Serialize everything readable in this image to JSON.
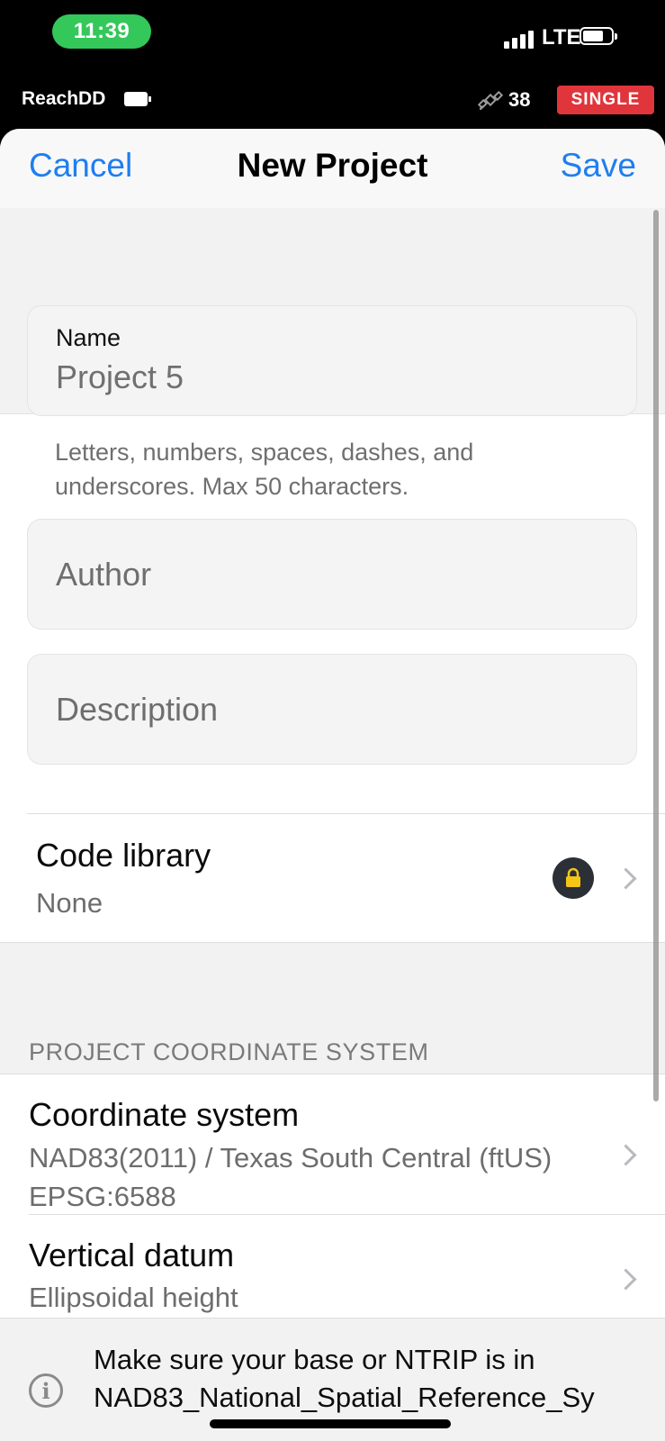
{
  "status_bar": {
    "time": "11:39",
    "network": "LTE"
  },
  "receiver_bar": {
    "device_name": "ReachDD",
    "satellite_count": "38",
    "solution_status": "SINGLE"
  },
  "nav": {
    "cancel_label": "Cancel",
    "title": "New Project",
    "save_label": "Save"
  },
  "form": {
    "name": {
      "label": "Name",
      "value": "Project 5",
      "hint": "Letters, numbers, spaces, dashes, and underscores. Max 50 characters."
    },
    "author": {
      "placeholder": "Author"
    },
    "description": {
      "placeholder": "Description"
    },
    "code_library": {
      "label": "Code library",
      "value": "None",
      "locked": true
    }
  },
  "coordinate_section": {
    "header": "PROJECT COORDINATE SYSTEM",
    "coordinate_system": {
      "label": "Coordinate system",
      "value_line1": "NAD83(2011) / Texas South Central (ftUS)",
      "value_line2": "EPSG:6588"
    },
    "vertical_datum": {
      "label": "Vertical datum",
      "value": "Ellipsoidal height"
    }
  },
  "info": {
    "line1": "Make sure your base or NTRIP is in",
    "line2": "NAD83_National_Spatial_Reference_Sy"
  },
  "colors": {
    "accent": "#1f7ef0",
    "status_pill": "#34c759",
    "single_badge": "#e0353b",
    "lock_icon": "#f5c518"
  }
}
